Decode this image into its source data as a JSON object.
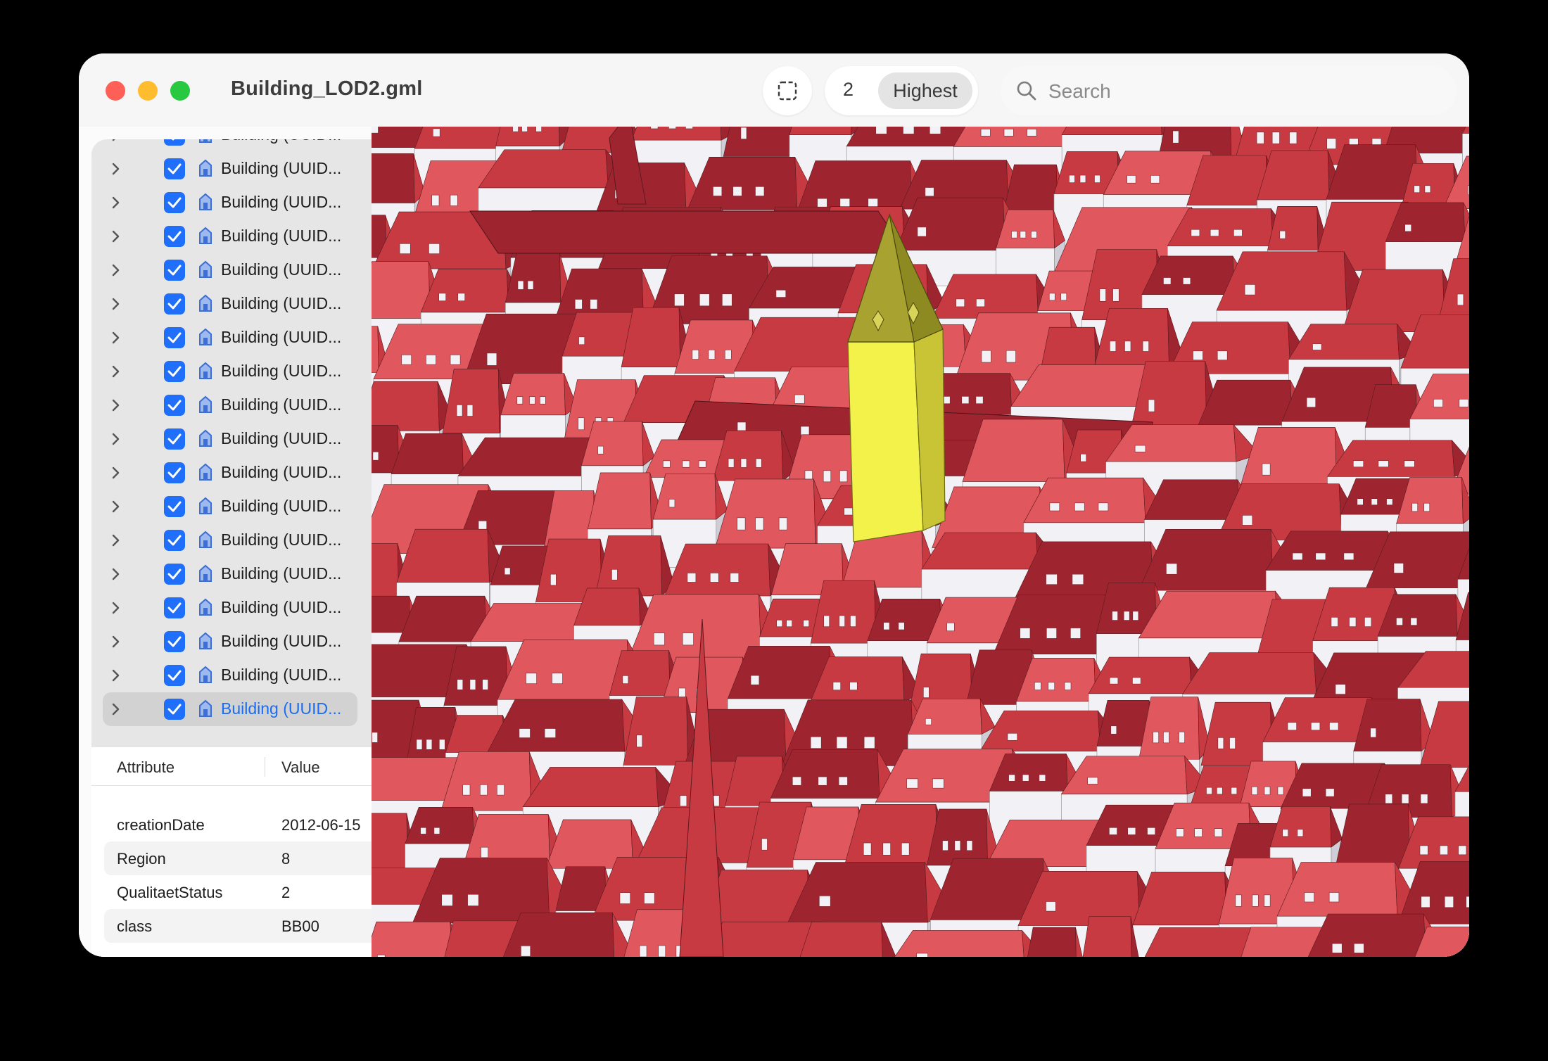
{
  "window": {
    "title": "Building_LOD2.gml"
  },
  "toolbar": {
    "lod_level": "2",
    "lod_mode": "Highest",
    "search_placeholder": "Search"
  },
  "tree": {
    "rows": [
      "Building (UUID...",
      "Building (UUID...",
      "Building (UUID...",
      "Building (UUID...",
      "Building (UUID...",
      "Building (UUID...",
      "Building (UUID...",
      "Building (UUID...",
      "Building (UUID...",
      "Building (UUID...",
      "Building (UUID...",
      "Building (UUID...",
      "Building (UUID...",
      "Building (UUID...",
      "Building (UUID...",
      "Building (UUID...",
      "Building (UUID...",
      "Building (UUID..."
    ],
    "selected_index": 17
  },
  "attributes": {
    "header_attribute": "Attribute",
    "header_value": "Value",
    "rows": [
      {
        "key": "creationDate",
        "value": "2012-06-15"
      },
      {
        "key": "Region",
        "value": "8"
      },
      {
        "key": "QualitaetStatus",
        "value": "2"
      },
      {
        "key": "class",
        "value": "BB00"
      }
    ]
  },
  "colors": {
    "roof": "#c83a42",
    "roof_dark": "#9e2530",
    "roof_light": "#e0575e",
    "wall": "#f2f1f6",
    "wall_shade": "#cfcdd6",
    "selected_building": "#f2f24a",
    "selected_roof": "#a8a230",
    "checkbox": "#1f6ffa"
  },
  "icons": {
    "select": "selection-rect-icon",
    "search": "search-icon",
    "expand": "chevron-right-icon",
    "checkbox": "checkmark-icon",
    "building": "building-icon"
  }
}
